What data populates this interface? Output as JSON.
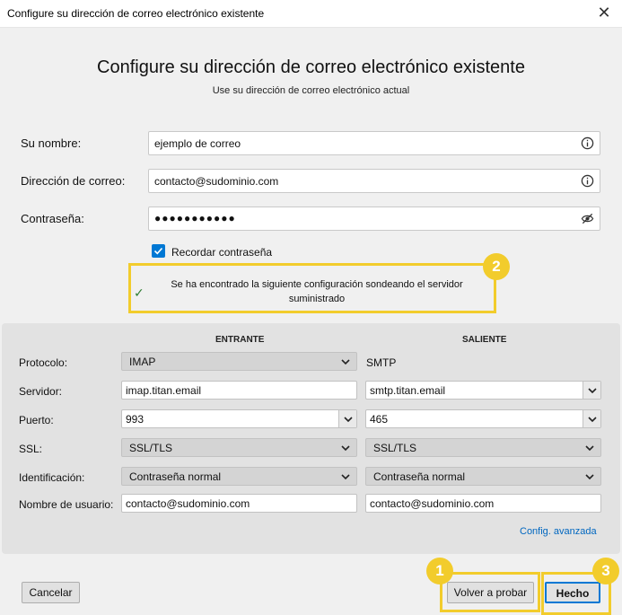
{
  "window": {
    "title": "Configure su dirección de correo electrónico existente"
  },
  "header": {
    "title": "Configure su dirección de correo electrónico existente",
    "subtitle": "Use su dirección de correo electrónico actual"
  },
  "form": {
    "name": {
      "label": "Su nombre:",
      "value": "ejemplo de correo",
      "icon": "info-icon"
    },
    "email": {
      "label": "Dirección de correo:",
      "value": "contacto@sudominio.com",
      "icon": "info-icon"
    },
    "password": {
      "label": "Contraseña:",
      "value": "●●●●●●●●●●●",
      "icon": "eye-slash-icon"
    },
    "remember": {
      "label": "Recordar contraseña",
      "checked": true
    }
  },
  "notice": {
    "text": "Se ha encontrado la siguiente configuración sondeando el servidor suministrado",
    "icon": "check-icon"
  },
  "badges": {
    "b1": "1",
    "b2": "2",
    "b3": "3"
  },
  "config": {
    "incoming_header": "ENTRANTE",
    "outgoing_header": "SALIENTE",
    "rows": {
      "protocol": {
        "label": "Protocolo:",
        "incoming": "IMAP",
        "outgoing": "SMTP"
      },
      "server": {
        "label": "Servidor:",
        "incoming": "imap.titan.email",
        "outgoing": "smtp.titan.email"
      },
      "port": {
        "label": "Puerto:",
        "incoming": "993",
        "outgoing": "465"
      },
      "ssl": {
        "label": "SSL:",
        "incoming": "SSL/TLS",
        "outgoing": "SSL/TLS"
      },
      "auth": {
        "label": "Identificación:",
        "incoming": "Contraseña normal",
        "outgoing": "Contraseña normal"
      },
      "username": {
        "label": "Nombre de usuario:",
        "incoming": "contacto@sudominio.com",
        "outgoing": "contacto@sudominio.com"
      }
    },
    "advanced_link": "Config. avanzada"
  },
  "buttons": {
    "cancel": "Cancelar",
    "retest": "Volver a probar",
    "done": "Hecho"
  },
  "colors": {
    "highlight": "#f2cc2c",
    "accent": "#0078d4",
    "link": "#0067c0"
  }
}
